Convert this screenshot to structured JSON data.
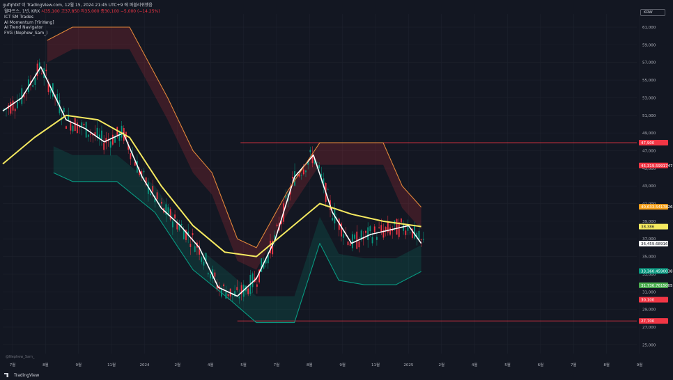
{
  "header": {
    "top_line": "gufqhtkf 이 TradingView.com, 12월 15, 2024 21:45 UTC+9 에 퍼블리쉬했음",
    "symbol": "월마트스, 1년, KRX",
    "ohlc": "시35,100 고37,850 저35,000 종30,100 −5,000 (−14.25%)",
    "indicators": [
      "ICT SM Trades",
      "AI Momentum [YinYang]",
      "AI Trend Navigator",
      "FVG (Nephew_Sam_)"
    ]
  },
  "currency": "KRW",
  "watermark": "@Nephew_Sam_",
  "footer": {
    "brand": "TradingView"
  },
  "chart_data": {
    "type": "line",
    "title": "",
    "ylim": [
      24000,
      62500
    ],
    "y_ticks": [
      "61,000",
      "59,000",
      "57,000",
      "55,000",
      "53,000",
      "51,000",
      "49,000",
      "47,000",
      "45,000",
      "43,000",
      "41,000",
      "39,000",
      "37,000",
      "35,000",
      "33,000",
      "31,000",
      "29,000",
      "27,000",
      "25,000"
    ],
    "x_ticks": [
      "7월",
      "8월",
      "9월",
      "11월",
      "2024",
      "2월",
      "4월",
      "5월",
      "7월",
      "8월",
      "9월",
      "11월",
      "2025",
      "2월",
      "4월",
      "5월",
      "6월",
      "7월",
      "8월",
      "9월"
    ],
    "price_tags": [
      {
        "label": "47,900",
        "value": 47900,
        "color": "#f23645"
      },
      {
        "label": "45,319.5991747",
        "value": 45320,
        "color": "#f23645"
      },
      {
        "label": "40,633.5417826",
        "value": 40634,
        "color": "#f7a21b"
      },
      {
        "label": "38,386",
        "value": 38386,
        "color": "#f5e960"
      },
      {
        "label": "36,459.6891644",
        "value": 36460,
        "color": "#ffffff"
      },
      {
        "label": "33,360.4590038",
        "value": 33360,
        "color": "#089981"
      },
      {
        "label": "31,736.7615005",
        "value": 31737,
        "color": "#4caf50"
      },
      {
        "label": "30,100",
        "value": 30100,
        "color": "#f23645"
      },
      {
        "label": "27,700",
        "value": 27700,
        "color": "#f23645"
      }
    ],
    "horizontal_levels": [
      {
        "value": 47900,
        "color": "#f23645"
      },
      {
        "value": 27700,
        "color": "#f23645"
      }
    ],
    "series": [
      {
        "color": "#ffffff",
        "x": [
          0,
          0.03,
          0.06,
          0.08,
          0.1,
          0.13,
          0.16,
          0.19,
          0.22,
          0.25,
          0.28,
          0.31,
          0.34,
          0.37,
          0.4,
          0.43,
          0.46,
          0.49,
          0.52,
          0.55,
          0.58,
          0.61,
          0.64,
          0.66
        ],
        "values": [
          51500,
          53000,
          56500,
          53500,
          50500,
          49500,
          48000,
          49000,
          44000,
          40500,
          38500,
          36000,
          31500,
          30500,
          32500,
          37000,
          44000,
          46500,
          40000,
          36500,
          37500,
          38000,
          38500,
          36500
        ]
      },
      {
        "color": "#f5e960",
        "x": [
          0,
          0.05,
          0.1,
          0.15,
          0.2,
          0.25,
          0.3,
          0.35,
          0.4,
          0.45,
          0.5,
          0.55,
          0.6,
          0.66
        ],
        "values": [
          45500,
          48500,
          51000,
          50500,
          48500,
          43000,
          38500,
          35500,
          35000,
          38000,
          41000,
          39800,
          39000,
          38400
        ]
      },
      {
        "color": "#089981",
        "x": [
          0.08,
          0.11,
          0.14,
          0.18,
          0.24,
          0.3,
          0.36,
          0.4,
          0.46,
          0.5,
          0.53,
          0.57,
          0.62,
          0.66
        ],
        "values": [
          44500,
          43500,
          43500,
          43500,
          40000,
          33500,
          30000,
          27500,
          27500,
          36500,
          32300,
          31800,
          31800,
          33300
        ]
      },
      {
        "color": "#e0863a",
        "x": [
          0.07,
          0.11,
          0.15,
          0.2,
          0.26,
          0.3,
          0.33,
          0.37,
          0.4,
          0.45,
          0.5,
          0.55,
          0.6,
          0.63,
          0.66
        ],
        "values": [
          59500,
          61000,
          61000,
          61000,
          53000,
          47000,
          44500,
          37000,
          36000,
          42500,
          47900,
          47900,
          47900,
          43000,
          40600
        ]
      }
    ]
  }
}
